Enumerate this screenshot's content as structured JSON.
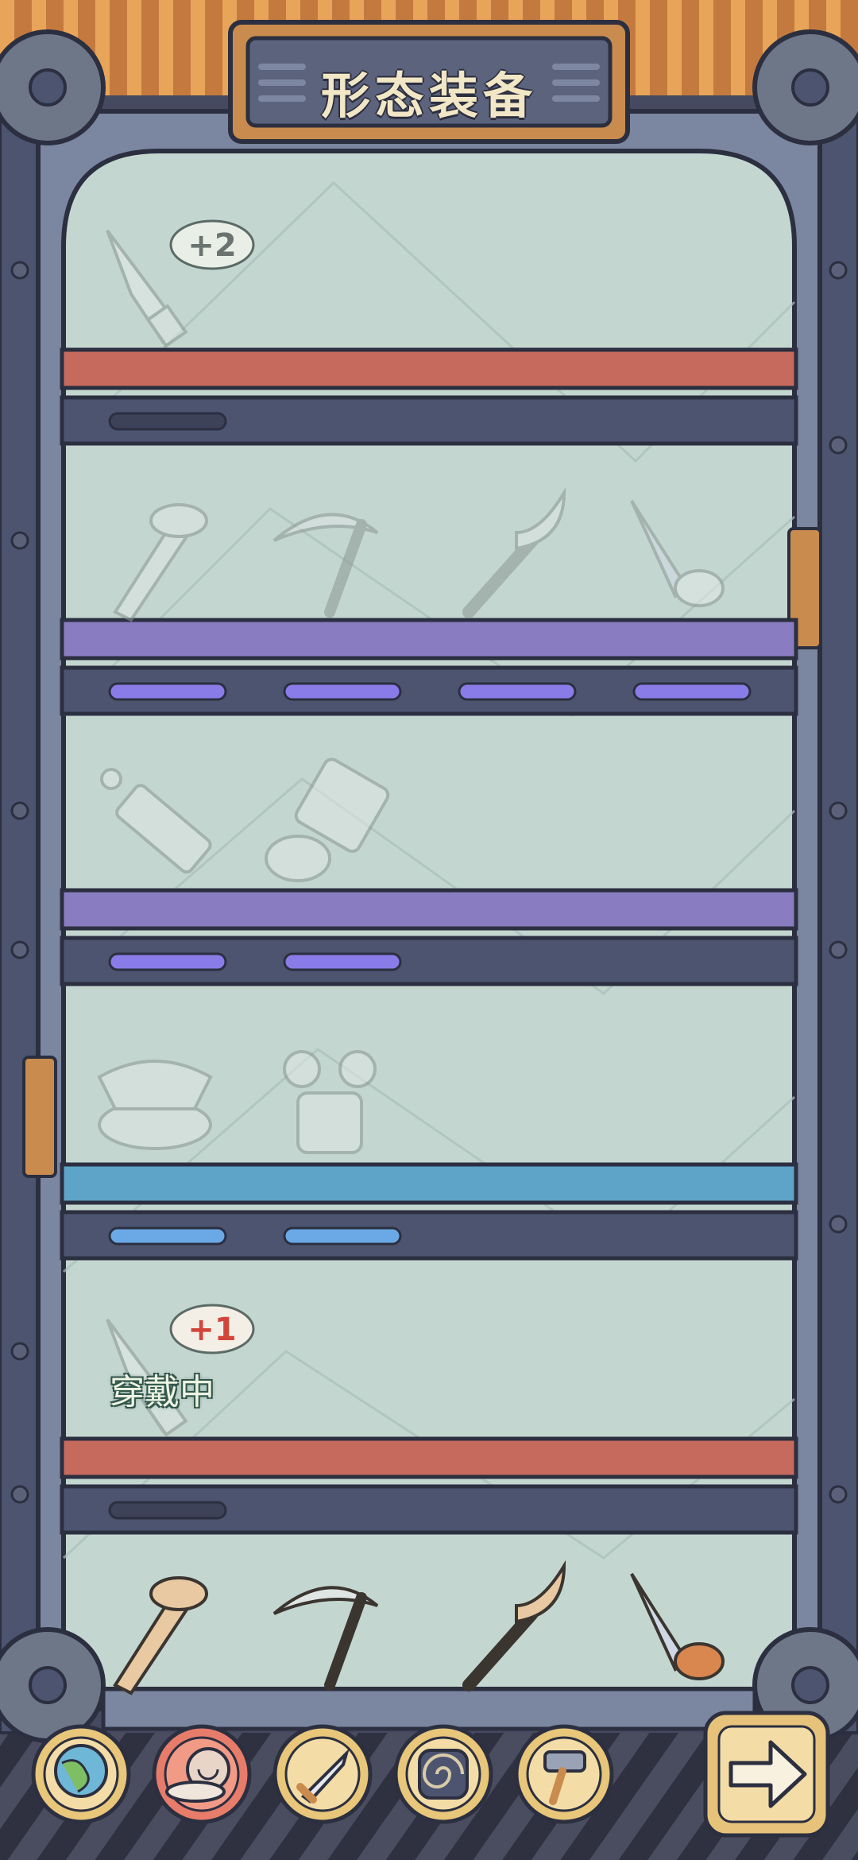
{
  "header": {
    "title": "形态装备"
  },
  "shelves": [
    {
      "name": "red",
      "color": "#c66a5e",
      "progress_total": 1,
      "progress_filled": 0,
      "items": [
        {
          "icon": "jagged-blade-icon",
          "badge": "+2"
        }
      ]
    },
    {
      "name": "purple",
      "color": "#8a7cc0",
      "progress_total": 4,
      "progress_filled": 4,
      "items": [
        {
          "icon": "bone-club-icon"
        },
        {
          "icon": "scythe-icon"
        },
        {
          "icon": "horn-staff-icon"
        },
        {
          "icon": "leaf-dagger-icon"
        }
      ]
    },
    {
      "name": "purple-2",
      "color": "#8a7cc0",
      "progress_total": 2,
      "progress_filled": 2,
      "items": [
        {
          "icon": "blaster-gun-icon"
        },
        {
          "icon": "mech-gauntlet-icon"
        }
      ]
    },
    {
      "name": "blue",
      "color": "#5ea3c8",
      "progress_total": 2,
      "progress_filled": 2,
      "items": [
        {
          "icon": "lotus-crown-icon"
        },
        {
          "icon": "plant-helmet-icon"
        }
      ]
    },
    {
      "name": "red-2",
      "color": "#c66a5e",
      "progress_total": 1,
      "progress_filled": 0,
      "items": [
        {
          "icon": "jagged-blade-icon",
          "badge": "+1",
          "status": "穿戴中"
        }
      ]
    }
  ],
  "bottom_shelf_items": [
    "bone-club-icon",
    "scythe-icon",
    "horn-staff-icon",
    "leaf-dagger-icon"
  ],
  "nav": {
    "items": [
      {
        "name": "globe-icon",
        "active": false
      },
      {
        "name": "snail-icon",
        "active": true
      },
      {
        "name": "sword-icon",
        "active": false
      },
      {
        "name": "spiral-shell-icon",
        "active": false
      },
      {
        "name": "hammer-icon",
        "active": false
      }
    ],
    "next": "arrow-right-icon"
  },
  "colors": {
    "frame": "#6f7a93",
    "glass": "#c4d6d0",
    "nav_gold": "#e8c67a",
    "nav_active": "#e77c6a"
  }
}
